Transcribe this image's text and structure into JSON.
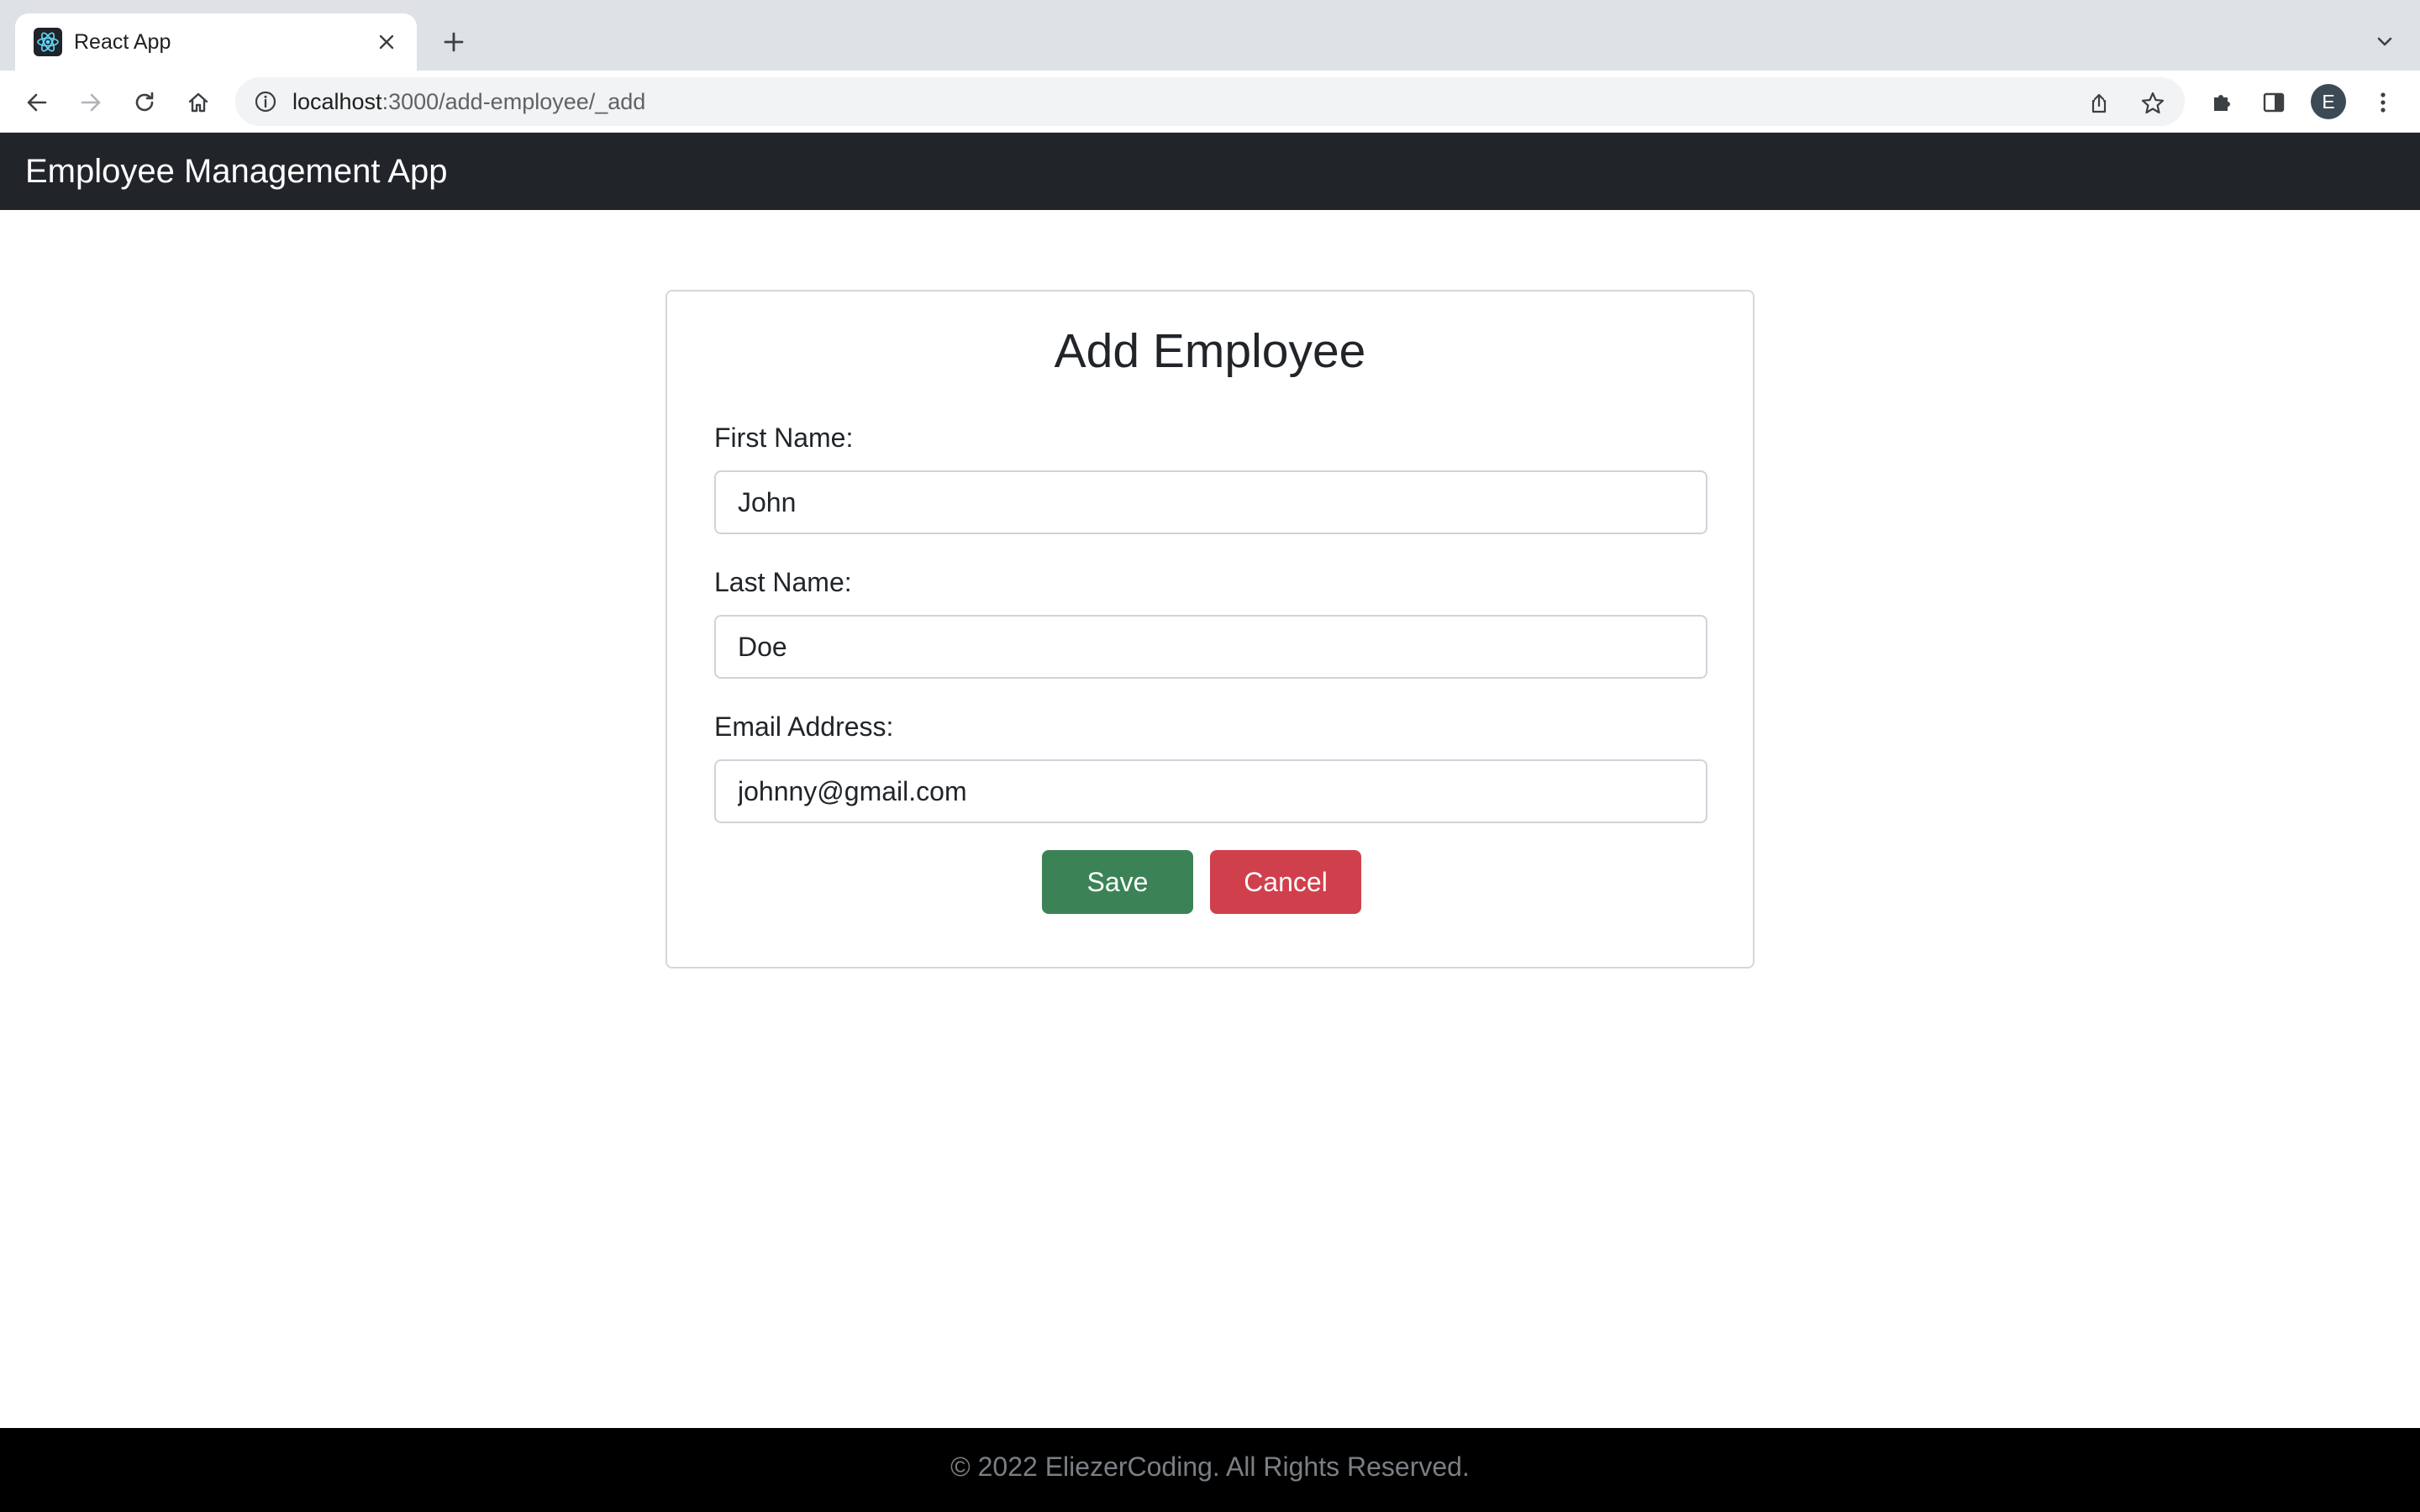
{
  "browser": {
    "tab_title": "React App",
    "url_host": "localhost",
    "url_path": ":3000/add-employee/_add",
    "profile_initial": "E",
    "icons": {
      "favicon": "react-logo-icon",
      "close": "close-icon",
      "new_tab": "plus-icon",
      "tab_search": "chevron-down-icon",
      "back": "back-arrow-icon",
      "forward": "forward-arrow-icon",
      "reload": "reload-icon",
      "home": "home-icon",
      "site_info": "info-icon",
      "share": "share-icon",
      "bookmark": "star-icon",
      "extensions": "puzzle-icon",
      "side_panel": "side-panel-icon",
      "menu": "kebab-menu-icon"
    }
  },
  "app": {
    "brand": "Employee Management App",
    "header_color": "#212529"
  },
  "form": {
    "title": "Add Employee",
    "first_name": {
      "label": "First Name:",
      "value": "John"
    },
    "last_name": {
      "label": "Last Name:",
      "value": "Doe"
    },
    "email": {
      "label": "Email Address:",
      "value": "johnny@gmail.com"
    },
    "save_label": "Save",
    "cancel_label": "Cancel",
    "save_color": "#3b8356",
    "cancel_color": "#d0404c"
  },
  "footer": {
    "text": "© 2022 EliezerCoding. All Rights Reserved."
  }
}
